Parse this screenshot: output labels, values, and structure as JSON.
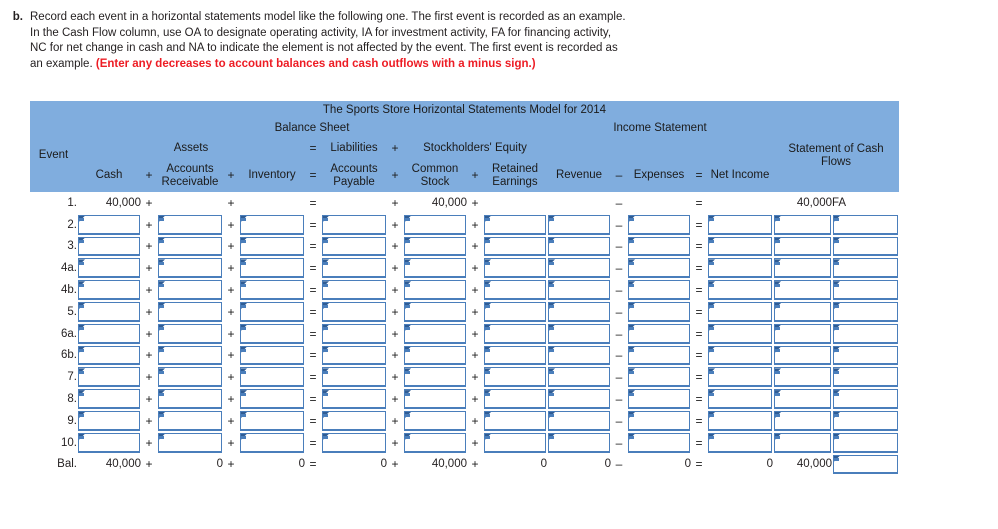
{
  "question": {
    "letter": "b.",
    "text_part1": "Record each event in a horizontal statements model like the following one. The first event is recorded as an example. In the Cash Flow column, use OA to designate operating activity, IA for investment activity, FA for financing activity, NC for net change in cash and NA to indicate the element is not affected by the event. The first event is recorded as an example. ",
    "text_emphasis": "(Enter any decreases to account balances and cash outflows with a minus sign.)"
  },
  "table": {
    "title": "The Sports Store Horizontal Statements Model for 2014",
    "bands": {
      "balance_sheet": "Balance Sheet",
      "income_statement": "Income Statement",
      "cash_flows": "Statement of Cash Flows"
    },
    "groups": {
      "event": "Event",
      "assets": "Assets",
      "liabilities": "Liabilities",
      "stockholders_equity": "Stockholders' Equity"
    },
    "columns": {
      "cash": "Cash",
      "accounts_receivable": "Accounts Receivable",
      "inventory": "Inventory",
      "accounts_payable": "Accounts Payable",
      "common_stock": "Common Stock",
      "retained_earnings": "Retained Earnings",
      "revenue": "Revenue",
      "expenses": "Expenses",
      "net_income": "Net Income"
    },
    "operators": {
      "plus": "+",
      "equals": "=",
      "minus": "–"
    },
    "rows": [
      {
        "label": "1.",
        "editable": false,
        "cash": "40,000",
        "accounts_receivable": "",
        "inventory": "",
        "accounts_payable": "",
        "common_stock": "40,000",
        "retained_earnings": "",
        "revenue": "",
        "expenses": "",
        "net_income": "",
        "cash_flow_amount": "40,000",
        "cash_flow_code": "FA"
      },
      {
        "label": "2.",
        "editable": true
      },
      {
        "label": "3.",
        "editable": true
      },
      {
        "label": "4a.",
        "editable": true
      },
      {
        "label": "4b.",
        "editable": true
      },
      {
        "label": "5.",
        "editable": true
      },
      {
        "label": "6a.",
        "editable": true
      },
      {
        "label": "6b.",
        "editable": true
      },
      {
        "label": "7.",
        "editable": true
      },
      {
        "label": "8.",
        "editable": true
      },
      {
        "label": "9.",
        "editable": true
      },
      {
        "label": "10.",
        "editable": true
      },
      {
        "label": "Bal.",
        "editable": false,
        "balance": true,
        "cash": "40,000",
        "accounts_receivable": "0",
        "inventory": "0",
        "accounts_payable": "0",
        "common_stock": "40,000",
        "retained_earnings": "0",
        "revenue": "0",
        "expenses": "0",
        "net_income": "0",
        "cash_flow_amount": "40,000",
        "cash_flow_code": ""
      }
    ]
  },
  "colors": {
    "header_blue": "#80ADDE",
    "input_border": "#4A7EBB",
    "emphasis_red": "#ed1c24",
    "grid": "#8c8c8c"
  }
}
